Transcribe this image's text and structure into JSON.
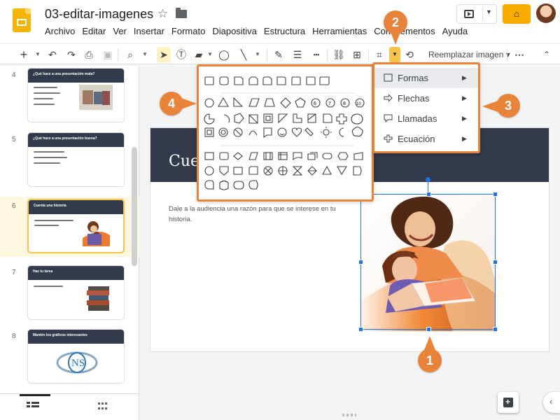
{
  "app": {
    "title": "03-editar-imagenes"
  },
  "menubar": {
    "items": [
      "Archivo",
      "Editar",
      "Ver",
      "Insertar",
      "Formato",
      "Diapositiva",
      "Estructura",
      "Herramientas",
      "Complementos",
      "Ayuda"
    ]
  },
  "toolbar": {
    "replace_image_label": "Reemplazar imagen"
  },
  "filmstrip": {
    "slides": [
      {
        "number": "4",
        "title": "¿Qué hace a una presentación mala?"
      },
      {
        "number": "5",
        "title": "¿Qué hace a una presentación buena?"
      },
      {
        "number": "6",
        "title": "Cuenta una historia"
      },
      {
        "number": "7",
        "title": "Haz tu tarea"
      },
      {
        "number": "8",
        "title": "Mantén los gráficos interesantes"
      }
    ],
    "active_slide": "6"
  },
  "slide": {
    "title": "Cue",
    "body": "Dale a la audiencia una razón para que se interese en tu historia."
  },
  "shape_menu": {
    "items": [
      "Formas",
      "Flechas",
      "Llamadas",
      "Ecuación"
    ],
    "active": "Formas"
  },
  "callouts": [
    "1",
    "2",
    "3",
    "4"
  ],
  "colors": {
    "accent_orange": "#e8833a",
    "yellow_highlight": "#f6c34b",
    "slide_header": "#323a4b",
    "selection_blue": "#1a73e8"
  }
}
